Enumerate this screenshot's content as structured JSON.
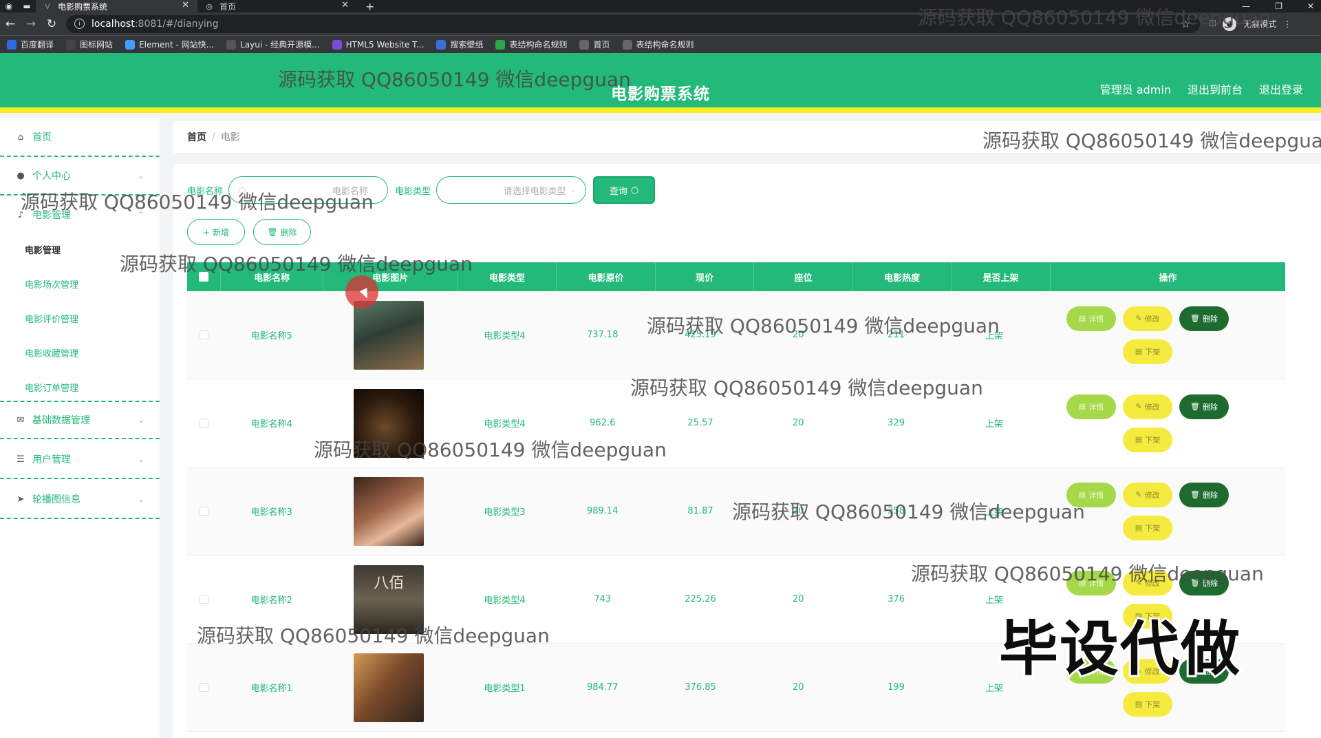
{
  "browser": {
    "tabs": [
      {
        "title": "电影购票系统",
        "active": true
      },
      {
        "title": "首页",
        "active": false
      }
    ],
    "url_host": "localhost",
    "url_rest": ":8081/#/dianying",
    "incognito_label": "无痕模式",
    "bookmarks": [
      {
        "label": "百度翻译",
        "icon": "translate-icon",
        "color": "#2d6cdf"
      },
      {
        "label": "图标网站",
        "icon": "flag-icon",
        "color": "#444444"
      },
      {
        "label": "Element - 网站快...",
        "icon": "element-icon",
        "color": "#409eff"
      },
      {
        "label": "Layui - 经典开源模...",
        "icon": "layui-icon",
        "color": "#555555"
      },
      {
        "label": "HTML5 Website T...",
        "icon": "html5-icon",
        "color": "#7a4bd6"
      },
      {
        "label": "搜索壁纸",
        "icon": "wallpaper-icon",
        "color": "#3a6fd8"
      },
      {
        "label": "表结构命名规则",
        "icon": "table-icon",
        "color": "#2aa84a"
      },
      {
        "label": "首页",
        "icon": "globe-icon",
        "color": "#666666"
      },
      {
        "label": "表结构命名规则",
        "icon": "globe-icon",
        "color": "#666666"
      }
    ]
  },
  "header": {
    "title": "电影购票系统",
    "links": [
      "管理员 admin",
      "退出到前台",
      "退出登录"
    ],
    "colors": {
      "primary": "#22b97a",
      "accent": "#f3ef23"
    }
  },
  "sidebar": {
    "home": "首页",
    "personal": "个人中心",
    "movie_mgmt": "电影管理",
    "sub_items": [
      "电影管理",
      "电影场次管理",
      "电影评价管理",
      "电影收藏管理",
      "电影订单管理"
    ],
    "basic_data": "基础数据管理",
    "user_mgmt": "用户管理",
    "carousel": "轮播图信息"
  },
  "breadcrumb": {
    "home": "首页",
    "sep": "/",
    "current": "电影"
  },
  "search": {
    "name_label": "电影名称",
    "name_placeholder": "电影名称",
    "type_label": "电影类型",
    "type_placeholder": "请选择电影类型",
    "query_label": "查询"
  },
  "actions": {
    "add_label": "+ 新增",
    "delete_label": "删除"
  },
  "table": {
    "headers": [
      "电影名称",
      "电影图片",
      "电影类型",
      "电影原价",
      "现价",
      "座位",
      "电影热度",
      "是否上架",
      "操作"
    ],
    "rows": [
      {
        "name": "电影名称5",
        "type": "电影类型4",
        "orig": "737.18",
        "now": "425.19",
        "seat": "20",
        "hot": "211",
        "shelf": "上架",
        "poster": "fantasy-poster"
      },
      {
        "name": "电影名称4",
        "type": "电影类型4",
        "orig": "962.6",
        "now": "25.57",
        "seat": "20",
        "hot": "329",
        "shelf": "上架",
        "poster": "film-reel-poster"
      },
      {
        "name": "电影名称3",
        "type": "电影类型3",
        "orig": "989.14",
        "now": "81.87",
        "seat": "20",
        "hot": "358",
        "shelf": "上架",
        "poster": "portrait-poster"
      },
      {
        "name": "电影名称2",
        "type": "电影类型4",
        "orig": "743",
        "now": "225.26",
        "seat": "20",
        "hot": "376",
        "shelf": "上架",
        "poster": "war-poster",
        "poster_text": "八佰"
      },
      {
        "name": "电影名称1",
        "type": "电影类型1",
        "orig": "984.77",
        "now": "376.85",
        "seat": "20",
        "hot": "199",
        "shelf": "上架",
        "poster": "couple-poster"
      }
    ],
    "op_labels": {
      "detail": "详情",
      "edit": "修改",
      "delete": "删除",
      "down": "下架"
    }
  },
  "overlay": {
    "watermark": "源码获取 QQ86050149 微信deepguan",
    "stamp": "毕设代做"
  }
}
